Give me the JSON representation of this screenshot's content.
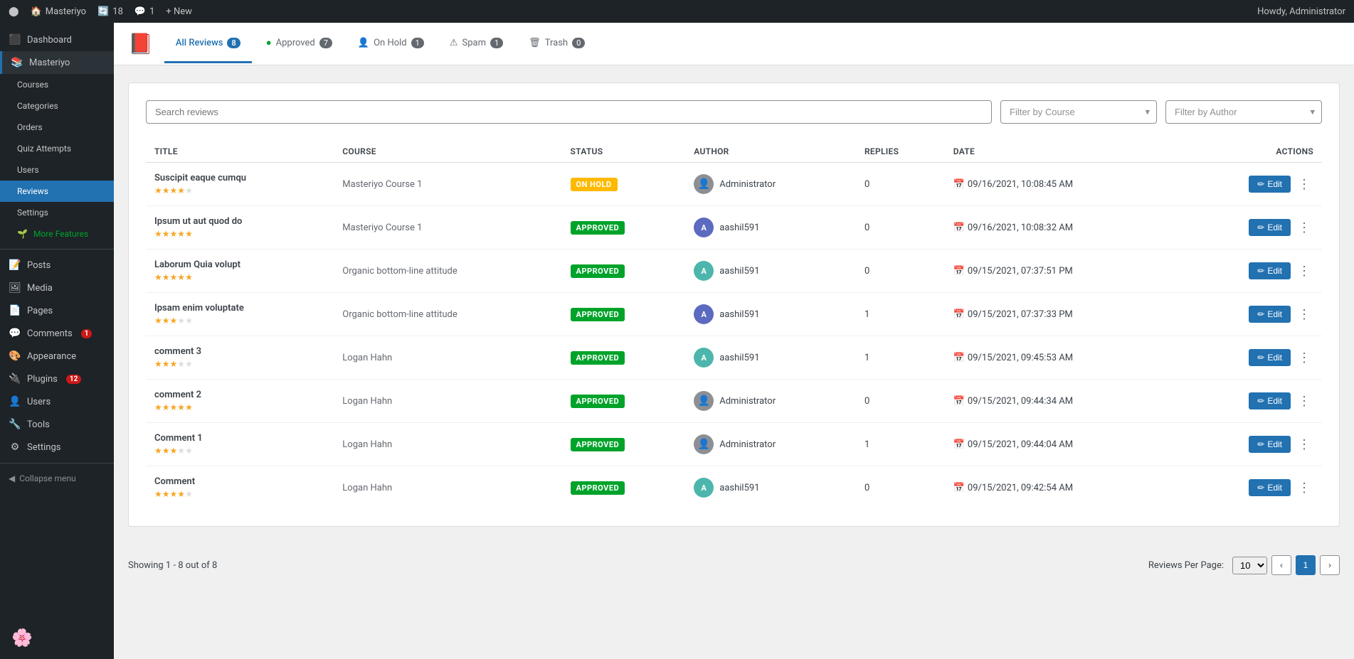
{
  "adminBar": {
    "siteIcon": "🏠",
    "siteName": "Masteriyo",
    "updatesCount": 18,
    "commentsCount": 1,
    "newLabel": "+ New",
    "userGreeting": "Howdy, Administrator"
  },
  "sidebar": {
    "items": [
      {
        "id": "dashboard",
        "label": "Dashboard",
        "icon": "🏠"
      },
      {
        "id": "masteriyo",
        "label": "Masteriyo",
        "icon": "📚",
        "active": true
      },
      {
        "id": "courses",
        "label": "Courses",
        "icon": ""
      },
      {
        "id": "categories",
        "label": "Categories",
        "icon": ""
      },
      {
        "id": "orders",
        "label": "Orders",
        "icon": ""
      },
      {
        "id": "quiz-attempts",
        "label": "Quiz Attempts",
        "icon": ""
      },
      {
        "id": "users",
        "label": "Users",
        "icon": ""
      },
      {
        "id": "reviews",
        "label": "Reviews",
        "icon": ""
      },
      {
        "id": "settings",
        "label": "Settings",
        "icon": ""
      },
      {
        "id": "more-features",
        "label": "More Features",
        "icon": "🌱",
        "green": true
      },
      {
        "id": "posts",
        "label": "Posts",
        "icon": "📝"
      },
      {
        "id": "media",
        "label": "Media",
        "icon": "🖼"
      },
      {
        "id": "pages",
        "label": "Pages",
        "icon": "📄"
      },
      {
        "id": "comments",
        "label": "Comments",
        "icon": "💬",
        "badge": 1
      },
      {
        "id": "appearance",
        "label": "Appearance",
        "icon": "🎨"
      },
      {
        "id": "plugins",
        "label": "Plugins",
        "icon": "🔌",
        "badge": 12
      },
      {
        "id": "users2",
        "label": "Users",
        "icon": "👤"
      },
      {
        "id": "tools",
        "label": "Tools",
        "icon": "🔧"
      },
      {
        "id": "settings2",
        "label": "Settings",
        "icon": "⚙"
      },
      {
        "id": "collapse",
        "label": "Collapse menu",
        "icon": "◀"
      }
    ]
  },
  "page": {
    "tabs": [
      {
        "id": "all",
        "label": "All Reviews",
        "count": 8,
        "active": true
      },
      {
        "id": "approved",
        "label": "Approved",
        "count": 7,
        "icon": "✅"
      },
      {
        "id": "onhold",
        "label": "On Hold",
        "count": 1,
        "icon": "👤"
      },
      {
        "id": "spam",
        "label": "Spam",
        "count": 1,
        "icon": "⚠"
      },
      {
        "id": "trash",
        "label": "Trash",
        "count": 0,
        "icon": "🗑"
      }
    ]
  },
  "filters": {
    "searchPlaceholder": "Search reviews",
    "filterByCourse": "Filter by Course",
    "filterByAuthor": "Filter by Author"
  },
  "table": {
    "columns": [
      "TITLE",
      "COURSE",
      "STATUS",
      "AUTHOR",
      "REPLIES",
      "DATE",
      "ACTIONS"
    ],
    "editLabel": "Edit",
    "rows": [
      {
        "id": 1,
        "title": "Suscipit eaque cumqu",
        "stars": 4,
        "course": "Masteriyo Course 1",
        "status": "ON HOLD",
        "statusType": "onhold",
        "author": "Administrator",
        "authorAvatar": "admin",
        "replies": 0,
        "date": "09/16/2021, 10:08:45 AM"
      },
      {
        "id": 2,
        "title": "Ipsum ut aut quod do",
        "stars": 5,
        "course": "Masteriyo Course 1",
        "status": "APPROVED",
        "statusType": "approved",
        "author": "aashil591",
        "authorAvatar": "user1",
        "replies": 0,
        "date": "09/16/2021, 10:08:32 AM"
      },
      {
        "id": 3,
        "title": "Laborum Quia volupt",
        "stars": 5,
        "course": "Organic bottom-line attitude",
        "status": "APPROVED",
        "statusType": "approved",
        "author": "aashil591",
        "authorAvatar": "user2",
        "replies": 0,
        "date": "09/15/2021, 07:37:51 PM"
      },
      {
        "id": 4,
        "title": "Ipsam enim voluptate",
        "stars": 3,
        "course": "Organic bottom-line attitude",
        "status": "APPROVED",
        "statusType": "approved",
        "author": "aashil591",
        "authorAvatar": "user1",
        "replies": 1,
        "date": "09/15/2021, 07:37:33 PM"
      },
      {
        "id": 5,
        "title": "comment 3",
        "stars": 3,
        "course": "Logan Hahn",
        "status": "APPROVED",
        "statusType": "approved",
        "author": "aashil591",
        "authorAvatar": "user2",
        "replies": 1,
        "date": "09/15/2021, 09:45:53 AM"
      },
      {
        "id": 6,
        "title": "comment 2",
        "stars": 5,
        "course": "Logan Hahn",
        "status": "APPROVED",
        "statusType": "approved",
        "author": "Administrator",
        "authorAvatar": "admin",
        "replies": 0,
        "date": "09/15/2021, 09:44:34 AM"
      },
      {
        "id": 7,
        "title": "Comment 1",
        "stars": 3,
        "course": "Logan Hahn",
        "status": "APPROVED",
        "statusType": "approved",
        "author": "Administrator",
        "authorAvatar": "admin",
        "replies": 1,
        "date": "09/15/2021, 09:44:04 AM"
      },
      {
        "id": 8,
        "title": "Comment",
        "stars": 4,
        "course": "Logan Hahn",
        "status": "APPROVED",
        "statusType": "approved",
        "author": "aashil591",
        "authorAvatar": "user2",
        "replies": 0,
        "date": "09/15/2021, 09:42:54 AM"
      }
    ]
  },
  "footer": {
    "showing": "Showing 1 - 8 out of 8",
    "perPageLabel": "Reviews Per Page:",
    "perPageValue": "10",
    "currentPage": 1
  }
}
